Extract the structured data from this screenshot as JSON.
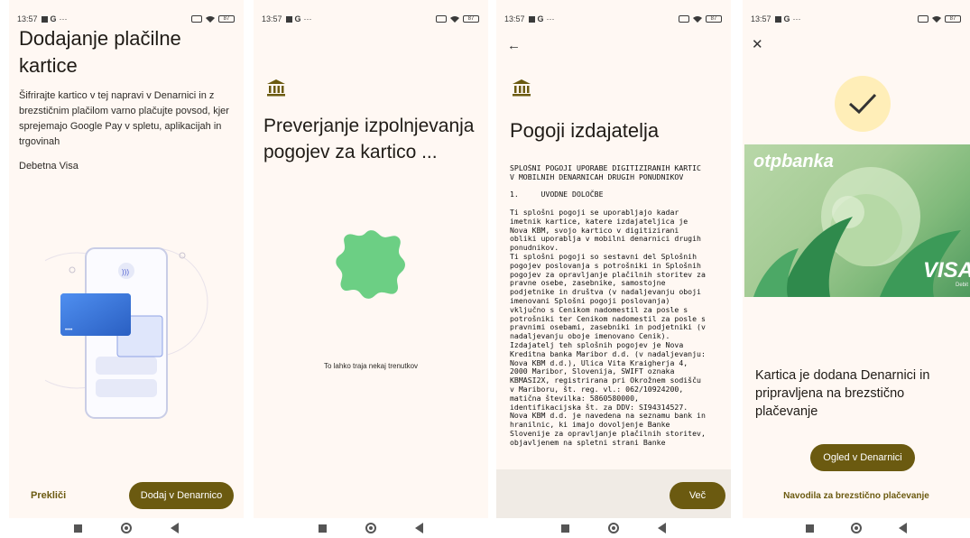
{
  "status": {
    "time": "13:57",
    "g_label": "G",
    "dots": "···",
    "battery": "87"
  },
  "screen1": {
    "title": "Dodajanje plačilne kartice",
    "description": "Šifrirajte kartico v tej napravi v Denarnici in z brezstičnim plačilom varno plačujte povsod, kjer sprejemajo Google Pay v spletu, aplikacijah in trgovinah",
    "card_type": "Debetna Visa",
    "cancel_label": "Prekliči",
    "add_label": "Dodaj v Denarnico"
  },
  "screen2": {
    "title": "Preverjanje izpolnjevanja pogojev za kartico ...",
    "wait_text": "To lahko traja nekaj trenutkov"
  },
  "screen3": {
    "title": "Pogoji izdajatelja",
    "terms": "SPLOŠNI POGOJI UPORABE DIGITIZIRANIH KARTIC\nV MOBILNIH DENARNICAH DRUGIH PONUDNIKOV\n\n1.     UVODNE DOLOČBE\n\nTi splošni pogoji se uporabljajo kadar\nimetnik kartice, katere izdajateljica je\nNova KBM, svojo kartico v digitizirani\nobliki uporablja v mobilni denarnici drugih\nponudnikov.\nTi splošni pogoji so sestavni del Splošnih\npogojev poslovanja s potrošniki in Splošnih\npogojev za opravljanje plačilnih storitev za\npravne osebe, zasebnike, samostojne\npodjetnike in društva (v nadaljevanju oboji\nimenovani Splošni pogoji poslovanja)\nvključno s Cenikom nadomestil za posle s\npotrošniki ter Cenikom nadomestil za posle s\npravnimi osebami, zasebniki in podjetniki (v\nnadaljevanju oboje imenovano Cenik).\nIzdajatelj teh splošnih pogojev je Nova\nKreditna banka Maribor d.d. (v nadaljevanju:\nNova KBM d.d.), Ulica Vita Kraigherja 4,\n2000 Maribor, Slovenija, SWIFT oznaka\nKBMASI2X, registrirana pri Okrožnem sodišču\nv Mariboru, št. reg. vl.: 062/10924200,\nmatična številka: 5860580000,\nidentifikacijska št. za DDV: SI94314527.\nNova KBM d.d. je navedena na seznamu bank in\nhranilnic, ki imajo dovoljenje Banke\nSlovenije za opravljanje plačilnih storitev,\nobjavljenem na spletni strani Banke",
    "more_label": "Več"
  },
  "screen4": {
    "card_brand": "otpbanka",
    "card_network": "VISA",
    "card_sub": "Debit",
    "message": "Kartica je dodana Denarnici in pripravljena na brezstično plačevanje",
    "view_label": "Ogled v Denarnici",
    "link_label": "Navodila za brezstično plačevanje"
  },
  "colors": {
    "accent": "#6b5a10",
    "background": "#fff8f3",
    "success_green": "#6ccf84",
    "check_bg": "#ffeeb8"
  },
  "icons": [
    "bank-icon",
    "back-arrow-icon",
    "close-icon",
    "check-icon",
    "nfc-icon",
    "wifi-icon",
    "battery-icon"
  ]
}
